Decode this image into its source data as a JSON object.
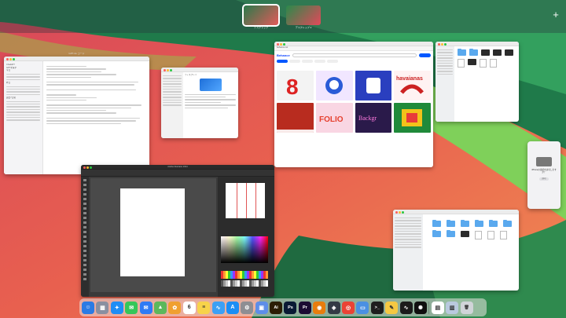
{
  "spaces": {
    "desktops": [
      {
        "label": "デスクトップ",
        "active": true
      },
      {
        "label": "デスクトップ 2",
        "active": false
      }
    ],
    "add_label": "+"
  },
  "windows": {
    "editor": {
      "title": "GPT-4o コード",
      "side_items": [
        "ChatGPT",
        "GPTを探す",
        "今日",
        "昨日",
        "過去7日間"
      ]
    },
    "settings": {
      "title": "ディスプレイ"
    },
    "browser": {
      "logo": "Behance",
      "url": "behance.net",
      "tags": [
        "おすすめ",
        "グラフィックデザイン",
        "写真",
        "イラスト",
        "3D"
      ]
    },
    "finder_top": {
      "title": "デスクトップ"
    },
    "finder_bottom": {
      "title": "ダウンロード"
    },
    "iphone": {
      "text": "iPhoneの接続を許可しますか？",
      "button": "許可"
    },
    "illustrator": {
      "title": "Adobe Illustrator 2024"
    }
  },
  "dock": {
    "apps": [
      {
        "icon": "finder-icon",
        "glyph": "☺",
        "color": "#2b7be4"
      },
      {
        "icon": "launchpad-icon",
        "glyph": "▦",
        "color": "#8a8fa0"
      },
      {
        "icon": "safari-icon",
        "glyph": "✦",
        "color": "#1e8df5"
      },
      {
        "icon": "messages-icon",
        "glyph": "✉",
        "color": "#34c759"
      },
      {
        "icon": "mail-icon",
        "glyph": "✉",
        "color": "#2f7bf5"
      },
      {
        "icon": "maps-icon",
        "glyph": "▲",
        "color": "#5cb85c"
      },
      {
        "icon": "photos-icon",
        "glyph": "✿",
        "color": "#f0a030"
      },
      {
        "icon": "calendar-icon",
        "glyph": "6",
        "color": "#ffffff"
      },
      {
        "icon": "notes-icon",
        "glyph": "≡",
        "color": "#f7d34a"
      },
      {
        "icon": "freeform-icon",
        "glyph": "∿",
        "color": "#3da0f5"
      },
      {
        "icon": "appstore-icon",
        "glyph": "A",
        "color": "#1c8ef5"
      },
      {
        "icon": "settings-icon",
        "glyph": "⚙",
        "color": "#8e8e93"
      },
      {
        "icon": "preview-icon",
        "glyph": "▣",
        "color": "#5d8ee8"
      },
      {
        "icon": "illustrator-icon",
        "glyph": "Ai",
        "color": "#2b1d05"
      },
      {
        "icon": "photoshop-icon",
        "glyph": "Ps",
        "color": "#0a1a34"
      },
      {
        "icon": "premiere-icon",
        "glyph": "Pr",
        "color": "#1a0b33"
      },
      {
        "icon": "blender-icon",
        "glyph": "◉",
        "color": "#e87d0d"
      },
      {
        "icon": "davinci-icon",
        "glyph": "◈",
        "color": "#333a45"
      },
      {
        "icon": "chrome-icon",
        "glyph": "◎",
        "color": "#ea4335"
      },
      {
        "icon": "screen-share-icon",
        "glyph": "▭",
        "color": "#4a90e2"
      },
      {
        "icon": "terminal-icon",
        "glyph": ">_",
        "color": "#1e1e1e"
      },
      {
        "icon": "notes-2-icon",
        "glyph": "✎",
        "color": "#f5c842"
      },
      {
        "icon": "activity-monitor-icon",
        "glyph": "∿",
        "color": "#1b1b1b"
      },
      {
        "icon": "chatgpt-icon",
        "glyph": "✺",
        "color": "#0f0f0f"
      },
      {
        "icon": "document-icon",
        "glyph": "▤",
        "color": "#ffffff"
      },
      {
        "icon": "downloads-icon",
        "glyph": "▥",
        "color": "#b9c9de"
      },
      {
        "icon": "trash-icon",
        "glyph": "🗑",
        "color": "#d0d4d8"
      }
    ]
  }
}
